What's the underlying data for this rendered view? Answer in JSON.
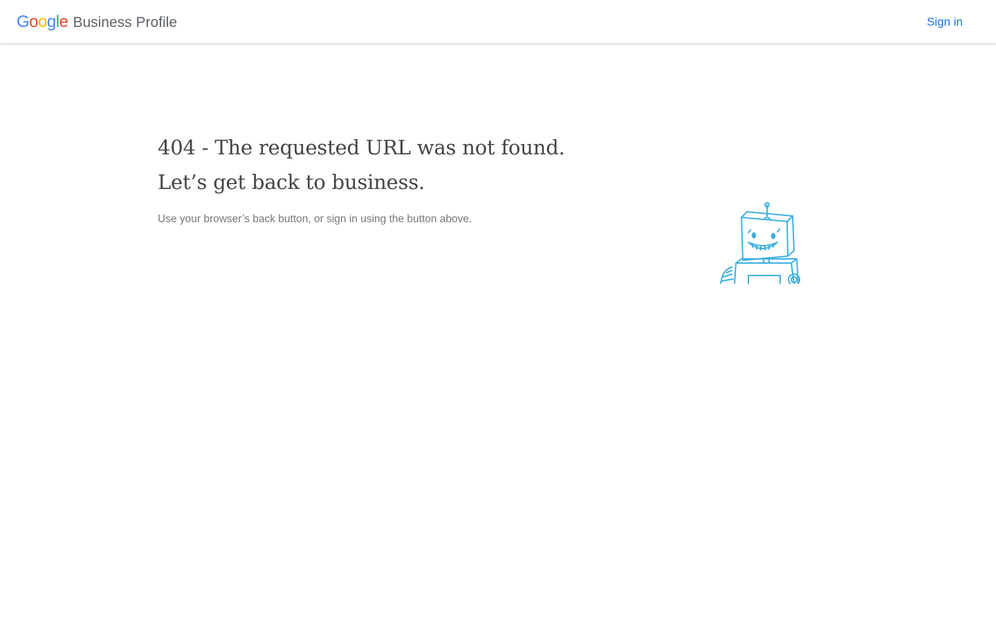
{
  "header": {
    "logo_letters": [
      {
        "char": "G",
        "color": "#4285F4"
      },
      {
        "char": "o",
        "color": "#EA4335"
      },
      {
        "char": "o",
        "color": "#FBBC05"
      },
      {
        "char": "g",
        "color": "#4285F4"
      },
      {
        "char": "l",
        "color": "#34A853"
      },
      {
        "char": "e",
        "color": "#EA4335"
      }
    ],
    "product_name": "Business Profile",
    "sign_in_label": "Sign in",
    "sign_in_color": "#1a73e8"
  },
  "error": {
    "title_line1": "404 - The requested URL was not found.",
    "title_line2": "Let’s get back to business.",
    "help_text": "Use your browser’s back button, or sign in using the button above."
  },
  "illustration": {
    "icon": "robot-icon",
    "stroke_color": "#3fb0e0"
  }
}
